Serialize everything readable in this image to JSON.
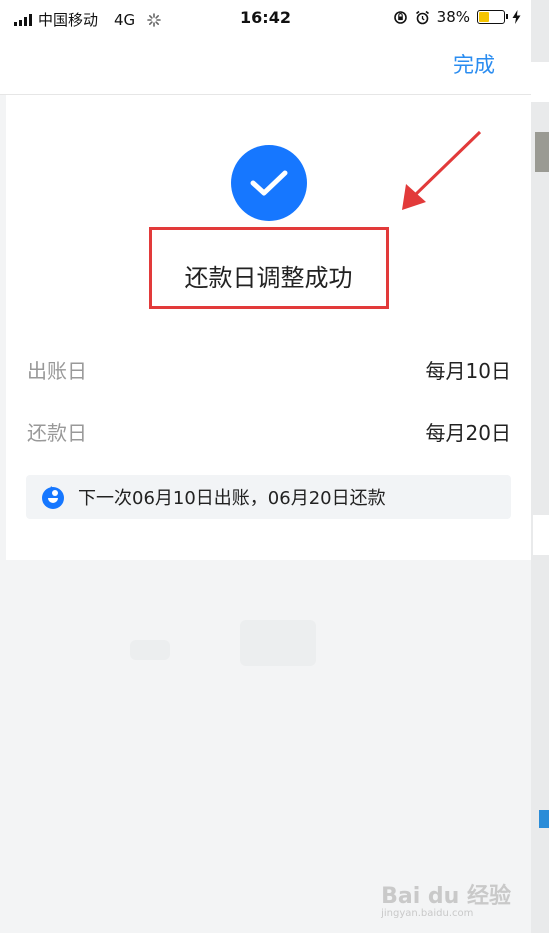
{
  "status_bar": {
    "carrier": "中国移动",
    "network": "4G",
    "time": "16:42",
    "battery_percent": "38%",
    "battery_level": 0.38,
    "battery_color": "#f5c400"
  },
  "nav": {
    "done_label": "完成"
  },
  "result": {
    "icon": "check-icon",
    "title": "还款日调整成功",
    "accent": "#1677ff"
  },
  "info_rows": [
    {
      "label": "出账日",
      "value": "每月10日"
    },
    {
      "label": "还款日",
      "value": "每月20日"
    }
  ],
  "notice": {
    "icon": "info-bird-icon",
    "text": "下一次06月10日出账，06月20日还款"
  },
  "annotation": {
    "box_color": "#e23a3a"
  },
  "watermark": {
    "brand": "Bai du 经验",
    "url": "jingyan.baidu.com"
  }
}
